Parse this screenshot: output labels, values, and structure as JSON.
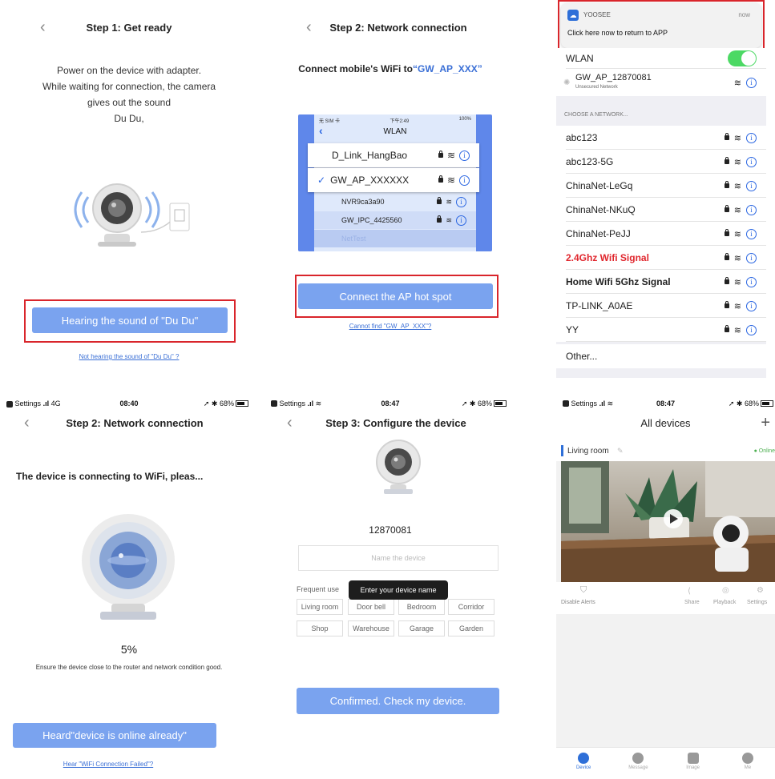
{
  "p1": {
    "title": "Step 1: Get ready",
    "instructions": [
      "Power on the device with adapter.",
      "While waiting for connection, the camera",
      "gives out the sound",
      "Du Du,"
    ],
    "primary_button": "Hearing the sound of \"Du Du\"",
    "link": "Not hearing the sound of \"Du Du\" ?"
  },
  "p2": {
    "title": "Step 2: Network connection",
    "prompt_prefix": "Connect mobile's WiFi to",
    "prompt_ssid": "“GW_AP_XXX”",
    "mock": {
      "carrier": "无 SIM 卡",
      "time": "下午2:49",
      "battery": "100%",
      "title": "WLAN",
      "networks": [
        "D_Link_HangBao",
        "GW_AP_XXXXXX",
        "NVR9ca3a90",
        "GW_IPC_4425560",
        "NetTest"
      ]
    },
    "primary_button": "Connect the AP hot spot",
    "link": "Cannot find \"GW_AP_XXX\"?"
  },
  "p3": {
    "notif_app": "YOOSEE",
    "notif_time": "now",
    "notif_text": "Click here now to return to APP",
    "wlan_label": "WLAN",
    "connected_name": "GW_AP_12870081",
    "connected_sub": "Unsecured Network",
    "section": "CHOOSE A NETWORK...",
    "networks": [
      {
        "name": "abc123"
      },
      {
        "name": "abc123-5G"
      },
      {
        "name": "ChinaNet-LeGq"
      },
      {
        "name": "ChinaNet-NKuQ"
      },
      {
        "name": "ChinaNet-PeJJ"
      },
      {
        "name": "2.4Ghz Wifi Signal"
      },
      {
        "name": "Home Wifi 5Ghz Signal"
      },
      {
        "name": "TP-LINK_A0AE"
      },
      {
        "name": "YY"
      }
    ],
    "other": "Other...",
    "highlight_color": "#e0262d"
  },
  "p4": {
    "status_left": "Settings",
    "status_net": "4G",
    "status_time": "08:40",
    "status_battery": "68%",
    "title": "Step 2: Network connection",
    "message": "The device is connecting to WiFi, pleas...",
    "progress_text": "5%",
    "progress_value": 5,
    "hint": "Ensure the device close to the router and network condition good.",
    "primary_button": "Heard\"device is online already\"",
    "link": "Hear \"WiFi Connection Failed\"?"
  },
  "p5": {
    "status_left": "Settings",
    "status_time": "08:47",
    "status_battery": "68%",
    "title": "Step 3: Configure the device",
    "device_id": "12870081",
    "name_placeholder": "Name the device",
    "frequent_label": "Frequent use",
    "tooltip": "Enter your device name",
    "tags": [
      "Living room",
      "Door bell",
      "Bedroom",
      "Corridor",
      "Shop",
      "Warehouse",
      "Garage",
      "Garden"
    ],
    "primary_button": "Confirmed. Check my device."
  },
  "p6": {
    "status_left": "Settings",
    "status_time": "08:47",
    "status_battery": "68%",
    "title": "All devices",
    "device_name": "Living room",
    "online": "Online",
    "actions": {
      "disable": "Disable Alerts",
      "share": "Share",
      "playback": "Playback",
      "settings": "Settings"
    },
    "tabs": [
      "Device",
      "Message",
      "Image",
      "Me"
    ]
  },
  "colors": {
    "accent": "#7aa3ef",
    "highlight": "#d9252b",
    "link": "#3a6fd6",
    "toggle": "#4cd964"
  }
}
